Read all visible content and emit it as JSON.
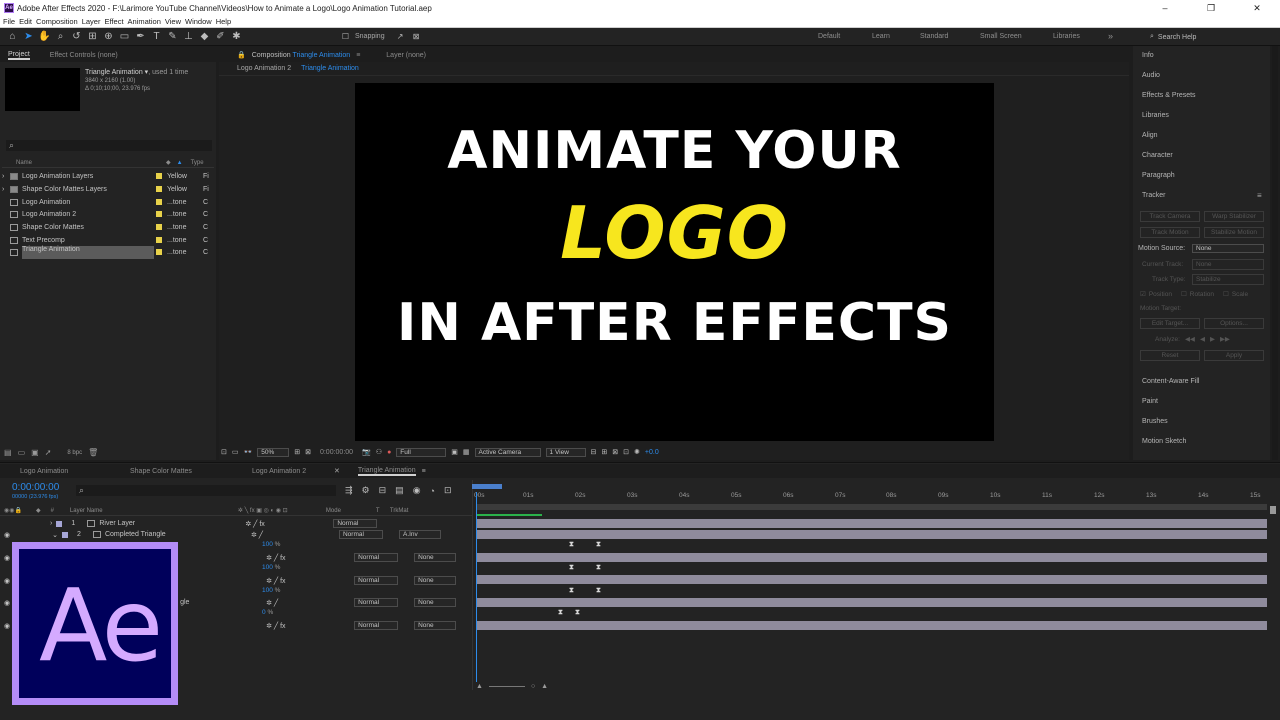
{
  "window": {
    "title": "Adobe After Effects 2020 - F:\\Larimore YouTube Channel\\Videos\\How to Animate a Logo\\Logo Animation Tutorial.aep",
    "controls": [
      "–",
      "❐",
      "✕"
    ]
  },
  "menu": [
    "File",
    "Edit",
    "Composition",
    "Layer",
    "Effect",
    "Animation",
    "View",
    "Window",
    "Help"
  ],
  "toolbar": {
    "snapping_label": "Snapping",
    "workspaces": [
      "Default",
      "Learn",
      "Standard",
      "Small Screen",
      "Libraries"
    ],
    "more": "»",
    "search_help": "Search Help"
  },
  "project_panel": {
    "tab_project": "Project",
    "tab_effect_controls": "Effect Controls (none)",
    "selected_name": "Triangle Animation",
    "used": ", used 1 time",
    "dimensions": "3840 x 2160 (1.00)",
    "duration": "Δ 0;10;10;00, 23.976 fps",
    "search_icon": "⌕",
    "col_name": "Name",
    "col_type": "Type",
    "items": [
      {
        "name": "Logo Animation Layers",
        "label": "Yellow",
        "type": "Fi",
        "kind": "folder"
      },
      {
        "name": "Shape Color Mattes Layers",
        "label": "Yellow",
        "type": "Fi",
        "kind": "folder"
      },
      {
        "name": "Logo Animation",
        "label": "...tone",
        "type": "C",
        "kind": "comp"
      },
      {
        "name": "Logo Animation 2",
        "label": "...tone",
        "type": "C",
        "kind": "comp"
      },
      {
        "name": "Shape Color Mattes",
        "label": "...tone",
        "type": "C",
        "kind": "comp"
      },
      {
        "name": "Text Precomp",
        "label": "...tone",
        "type": "C",
        "kind": "comp"
      },
      {
        "name": "Triangle Animation",
        "label": "...tone",
        "type": "C",
        "kind": "comp"
      }
    ],
    "bpc": "8 bpc"
  },
  "comp_panel": {
    "tab_prefix": "Composition",
    "tab_comp": "Triangle Animation",
    "tab_layer": "Layer (none)",
    "crumb_1": "Logo Animation 2",
    "crumb_2": "Triangle Animation",
    "headline_1": "ANIMATE YOUR",
    "headline_2": "LOGO",
    "headline_3": "IN AFTER EFFECTS",
    "zoom": "50%",
    "timecode": "0:00:00:00",
    "resolution": "Full",
    "camera": "Active Camera",
    "views": "1 View",
    "exposure": "+0.0"
  },
  "right_panel": {
    "items": [
      "Info",
      "Audio",
      "Effects & Presets",
      "Libraries",
      "Align",
      "Character",
      "Paragraph",
      "Tracker"
    ],
    "track_camera": "Track Camera",
    "warp_stabilizer": "Warp Stabilizer",
    "track_motion": "Track Motion",
    "stabilize_motion": "Stabilize Motion",
    "motion_source_label": "Motion Source:",
    "motion_source_value": "None",
    "current_track_label": "Current Track:",
    "current_track_value": "None",
    "track_type_label": "Track Type:",
    "track_type_value": "Stabilize",
    "position": "Position",
    "rotation": "Rotation",
    "scale": "Scale",
    "motion_target": "Motion Target:",
    "edit_target": "Edit Target...",
    "options": "Options...",
    "analyze": "Analyze:",
    "reset": "Reset",
    "apply": "Apply",
    "bottom_items": [
      "Content-Aware Fill",
      "Paint",
      "Brushes",
      "Motion Sketch"
    ]
  },
  "timeline": {
    "tabs": [
      "Logo Animation",
      "Shape Color Mattes",
      "Logo Animation 2",
      "Triangle Animation"
    ],
    "timecode": "0:00:00:00",
    "fps": "00000 (23.976 fps)",
    "col_layer_name": "Layer Name",
    "col_mode": "Mode",
    "col_t": "T",
    "col_trkmat": "TrkMat",
    "ticks": [
      "00s",
      "01s",
      "02s",
      "03s",
      "04s",
      "05s",
      "06s",
      "07s",
      "08s",
      "09s",
      "10s",
      "11s",
      "12s",
      "13s",
      "14s",
      "15s"
    ],
    "layers": [
      {
        "num": "1",
        "name": "River Layer",
        "mode": "Normal",
        "trkmat": ""
      },
      {
        "num": "2",
        "name": "Completed Triangle",
        "mode": "Normal",
        "trkmat": "A.Inv"
      }
    ],
    "sub_rows": [
      {
        "value": "100",
        "unit": "%",
        "mode": "Normal",
        "trkmat": "None"
      },
      {
        "value": "100",
        "unit": "%",
        "mode": "Normal",
        "trkmat": "None"
      },
      {
        "value": "100",
        "unit": "%",
        "name_tail": "gle",
        "mode": "Normal",
        "trkmat": "None"
      },
      {
        "value": "0",
        "unit": "%",
        "mode": "Normal",
        "trkmat": "None"
      }
    ]
  },
  "logo": {
    "text": "Ae"
  },
  "colors": {
    "accent": "#2d8ceb",
    "headline": "#ffffff",
    "logo_word": "#f7e61e",
    "label_yellow": "#e8d24a"
  }
}
